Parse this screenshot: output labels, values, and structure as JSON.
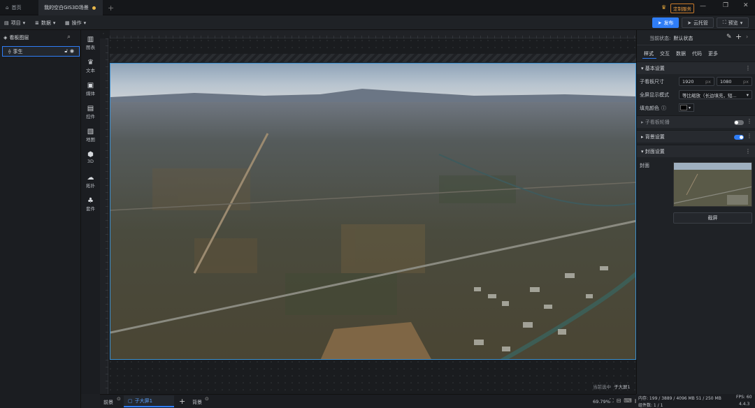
{
  "tabs": [
    {
      "label": "首页"
    },
    {
      "label": "我的空白GIS3D场景"
    }
  ],
  "window": {
    "custom_service": "定制服务"
  },
  "toolbar": {
    "project": "项目",
    "data": "数据",
    "ops": "操作",
    "publish": "发布",
    "cloud": "云托管",
    "preview": "预览"
  },
  "layers": {
    "title": "看板图层",
    "items": [
      {
        "label": "孪生"
      }
    ]
  },
  "iconbar": [
    {
      "label": "图表",
      "icon": "chart-icon"
    },
    {
      "label": "文本",
      "icon": "text-icon"
    },
    {
      "label": "媒体",
      "icon": "media-icon"
    },
    {
      "label": "控件",
      "icon": "widget-icon"
    },
    {
      "label": "地图",
      "icon": "map-icon"
    },
    {
      "label": "3D",
      "icon": "cube-icon"
    },
    {
      "label": "拓扑",
      "icon": "topology-icon"
    },
    {
      "label": "套件",
      "icon": "kit-icon"
    }
  ],
  "stage": {
    "watermark": "当前选中",
    "selected": "子大屏1"
  },
  "right": {
    "state_label": "当前状态:",
    "state_value": "默认状态",
    "tabs": [
      "样式",
      "交互",
      "数据",
      "代码",
      "更多"
    ],
    "basic": "基本设置",
    "size_label": "子看板尺寸",
    "width": "1920",
    "height": "1080",
    "unit": "px",
    "display_label": "全屏显示模式",
    "display_value": "等比缩放（长边填充，短...",
    "fill_label": "填充颜色",
    "carousel": "子看板轮播",
    "bg": "背景设置",
    "cover": "封面设置",
    "cover_label": "封面",
    "capture": "截屏"
  },
  "bottom": {
    "front": "前景",
    "screen": "子大屏1",
    "bg": "背景",
    "zoom": "69.79%"
  },
  "status": {
    "memory": "内存: 199 / 3889 / 4096 MB  51 / 250 MB",
    "fps_label": "FPS:",
    "fps": "60",
    "components": "组件数: 1 / 1",
    "version": "4.4.3"
  },
  "colors": {
    "accent": "#2f7df6",
    "fill": "#000000"
  }
}
